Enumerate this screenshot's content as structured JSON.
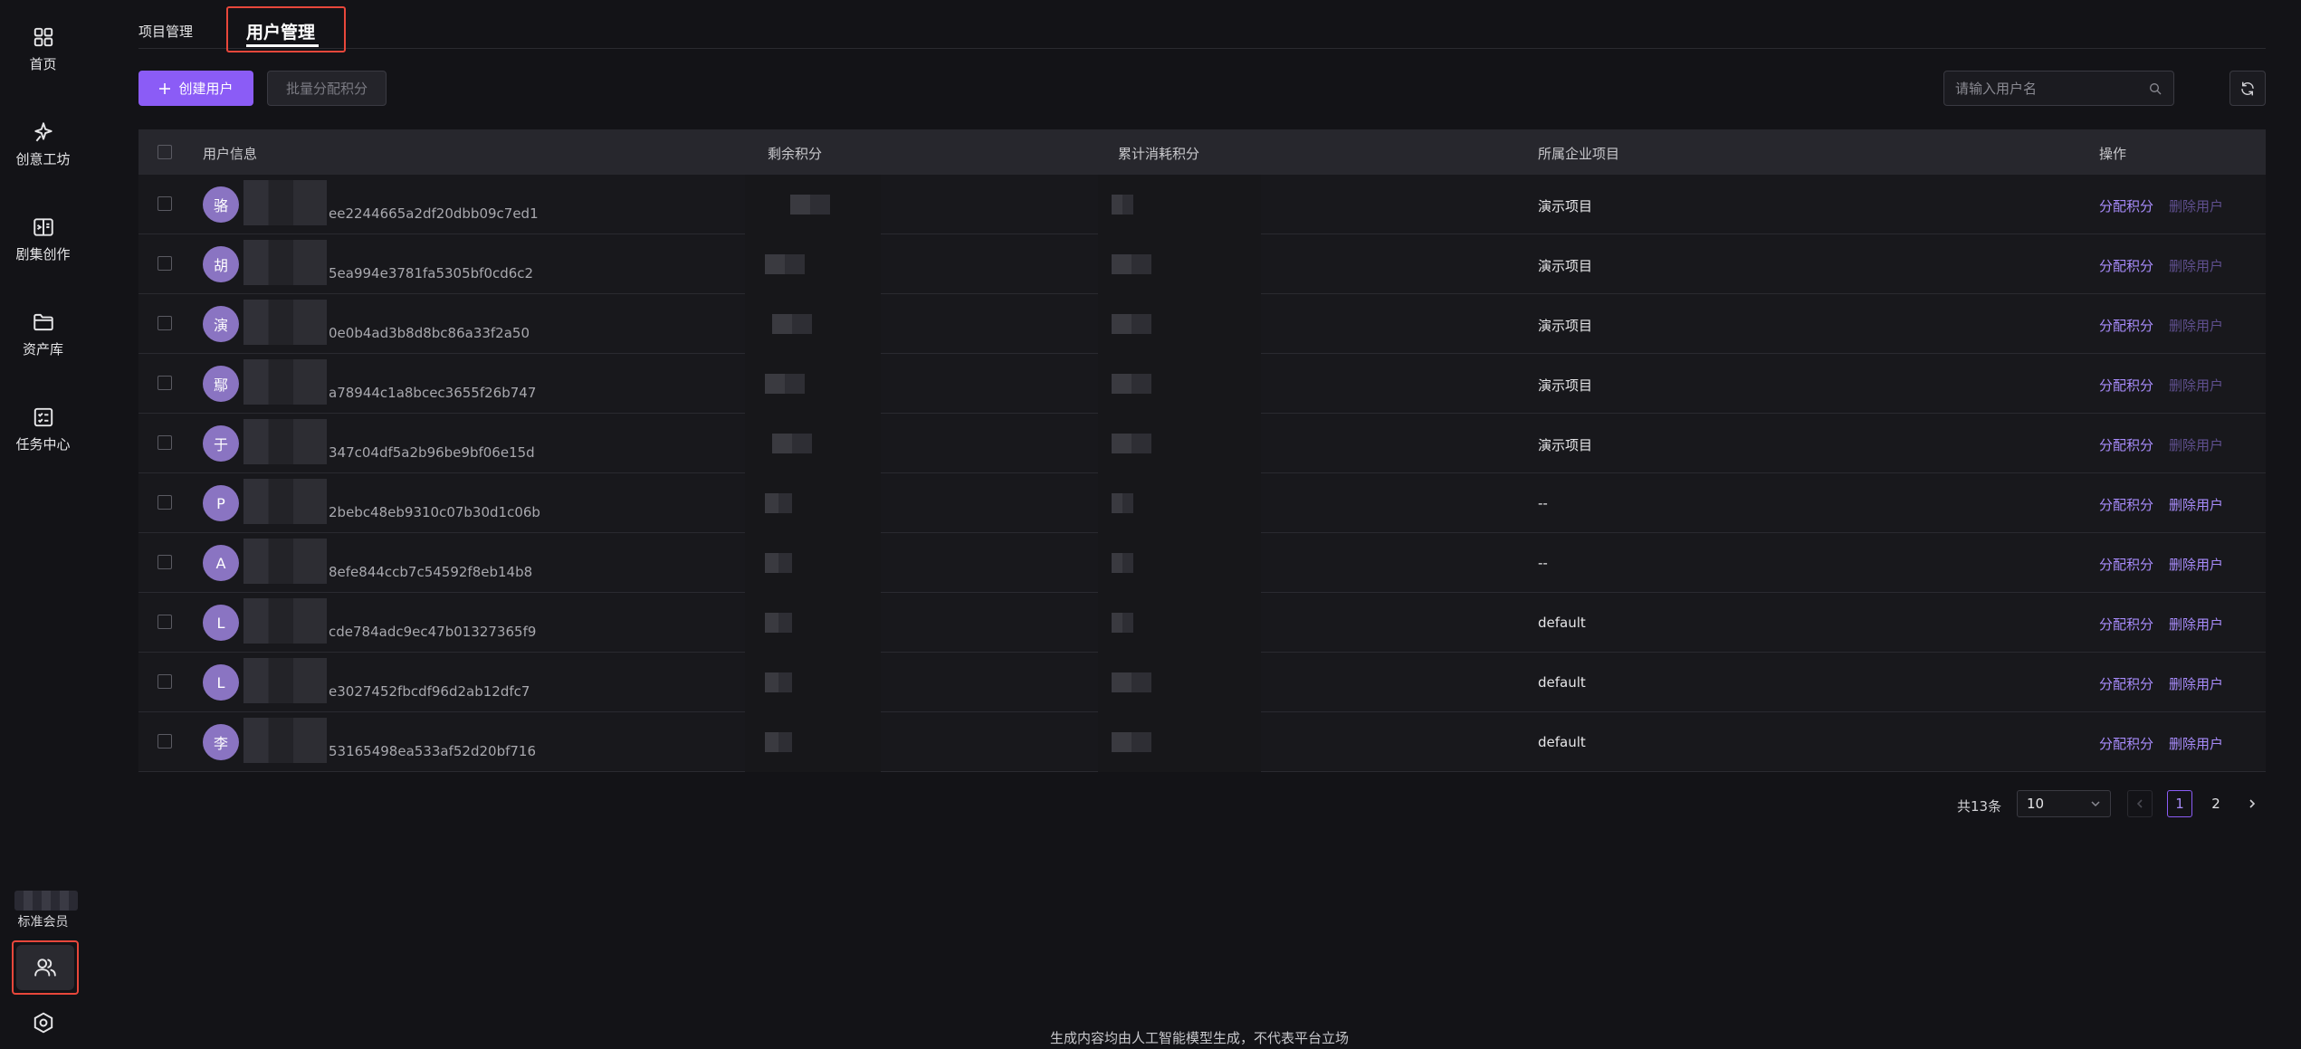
{
  "sidebar": {
    "items": [
      {
        "label": "首页",
        "icon": "dashboard-icon"
      },
      {
        "label": "创意工坊",
        "icon": "sparkle-pin-icon"
      },
      {
        "label": "剧集创作",
        "icon": "book-split-icon"
      },
      {
        "label": "资产库",
        "icon": "folder-icon"
      },
      {
        "label": "任务中心",
        "icon": "task-list-icon"
      }
    ],
    "member_label": "标准会员"
  },
  "tabs": {
    "project": "项目管理",
    "user": "用户管理"
  },
  "toolbar": {
    "create_label": "创建用户",
    "batch_label": "批量分配积分",
    "search_placeholder": "请输入用户名"
  },
  "table": {
    "headers": {
      "user_info": "用户信息",
      "remaining": "剩余积分",
      "consumed": "累计消耗积分",
      "project": "所属企业项目",
      "actions": "操作"
    },
    "rows": [
      {
        "initial": "骆",
        "uid_suffix": "ee2244665a2df20dbb09c7ed1",
        "project": "演示项目",
        "assign": "分配积分",
        "delete": "删除用户",
        "delete_disabled": true
      },
      {
        "initial": "胡",
        "uid_suffix": "5ea994e3781fa5305bf0cd6c2",
        "project": "演示项目",
        "assign": "分配积分",
        "delete": "删除用户",
        "delete_disabled": true
      },
      {
        "initial": "演",
        "uid_suffix": "0e0b4ad3b8d8bc86a33f2a50",
        "project": "演示项目",
        "assign": "分配积分",
        "delete": "删除用户",
        "delete_disabled": true
      },
      {
        "initial": "鄢",
        "uid_suffix": "a78944c1a8bcec3655f26b747",
        "project": "演示项目",
        "assign": "分配积分",
        "delete": "删除用户",
        "delete_disabled": true
      },
      {
        "initial": "于",
        "uid_suffix": "347c04df5a2b96be9bf06e15d",
        "project": "演示项目",
        "assign": "分配积分",
        "delete": "删除用户",
        "delete_disabled": true
      },
      {
        "initial": "P",
        "uid_suffix": "2bebc48eb9310c07b30d1c06b",
        "project": "--",
        "assign": "分配积分",
        "delete": "删除用户",
        "delete_disabled": false
      },
      {
        "initial": "A",
        "uid_suffix": "8efe844ccb7c54592f8eb14b8",
        "project": "--",
        "assign": "分配积分",
        "delete": "删除用户",
        "delete_disabled": false
      },
      {
        "initial": "L",
        "uid_suffix": "cde784adc9ec47b01327365f9",
        "project": "default",
        "assign": "分配积分",
        "delete": "删除用户",
        "delete_disabled": false
      },
      {
        "initial": "L",
        "uid_suffix": "e3027452fbcdf96d2ab12dfc7",
        "project": "default",
        "assign": "分配积分",
        "delete": "删除用户",
        "delete_disabled": false
      },
      {
        "initial": "李",
        "uid_suffix": "53165498ea533af52d20bf716",
        "project": "default",
        "assign": "分配积分",
        "delete": "删除用户",
        "delete_disabled": false
      }
    ]
  },
  "pagination": {
    "total": "共13条",
    "page_size": "10",
    "pages": [
      "1",
      "2"
    ],
    "current": "1"
  },
  "footer": {
    "note": "生成内容均由人工智能模型生成，不代表平台立场"
  },
  "colors": {
    "accent": "#8b5cf6",
    "link": "#a78bfa",
    "link_disabled": "#5f4f8f",
    "avatar": "#8a74c2",
    "highlight_border": "#e8473b",
    "background": "#131317"
  }
}
